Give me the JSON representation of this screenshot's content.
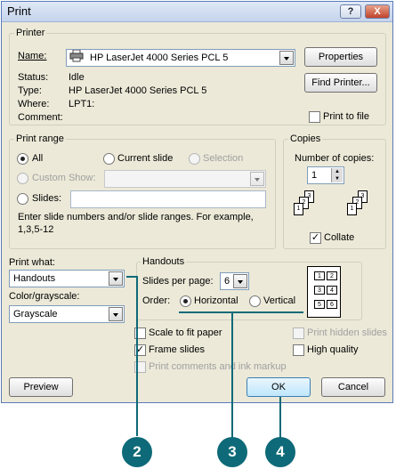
{
  "dialog": {
    "title": "Print",
    "help_label": "?",
    "close_label": "X"
  },
  "printer": {
    "legend": "Printer",
    "name_label": "Name:",
    "name_value": "HP LaserJet 4000 Series PCL 5",
    "properties_label": "Properties",
    "find_printer_label": "Find Printer...",
    "status_label": "Status:",
    "status_value": "Idle",
    "type_label": "Type:",
    "type_value": "HP LaserJet 4000 Series PCL 5",
    "where_label": "Where:",
    "where_value": "LPT1:",
    "comment_label": "Comment:",
    "print_to_file_label": "Print to file"
  },
  "print_range": {
    "legend": "Print range",
    "all_label": "All",
    "current_slide_label": "Current slide",
    "selection_label": "Selection",
    "custom_show_label": "Custom Show:",
    "slides_label": "Slides:",
    "hint": "Enter slide numbers and/or slide ranges. For example,",
    "hint_example": "1,3,5-12"
  },
  "copies": {
    "legend": "Copies",
    "number_label": "Number of copies:",
    "number_value": "1",
    "collate_label": "Collate",
    "page_numbers": [
      "1",
      "2",
      "3"
    ]
  },
  "print_what": {
    "label": "Print what:",
    "value": "Handouts"
  },
  "color": {
    "label": "Color/grayscale:",
    "value": "Grayscale"
  },
  "handouts": {
    "legend": "Handouts",
    "slides_per_page_label": "Slides per page:",
    "slides_per_page_value": "6",
    "order_label": "Order:",
    "horizontal_label": "Horizontal",
    "vertical_label": "Vertical",
    "preview_numbers": [
      "1",
      "2",
      "3",
      "4",
      "5",
      "6"
    ]
  },
  "options": {
    "scale_to_fit": "Scale to fit paper",
    "frame_slides": "Frame slides",
    "print_comments": "Print comments and ink markup",
    "print_hidden": "Print hidden slides",
    "high_quality": "High quality"
  },
  "buttons": {
    "preview": "Preview",
    "ok": "OK",
    "cancel": "Cancel"
  },
  "callouts": [
    "2",
    "3",
    "4"
  ],
  "colors": {
    "callout": "#0e6a78",
    "title_bar": "#c5d4ec",
    "dialog_bg": "#ece9d8"
  }
}
